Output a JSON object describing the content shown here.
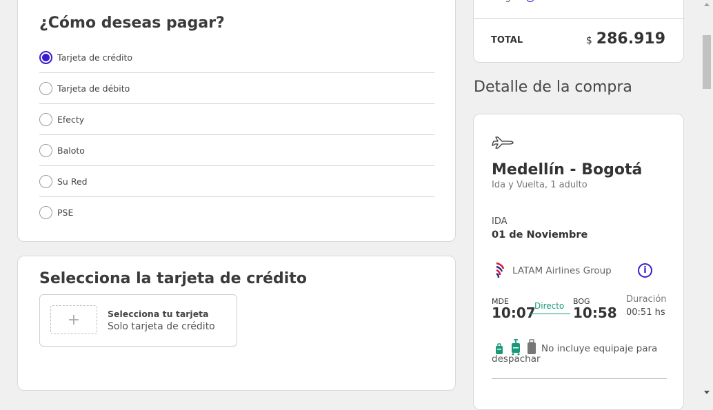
{
  "payment": {
    "title": "¿Cómo deseas pagar?",
    "options": [
      {
        "label": "Tarjeta de crédito",
        "selected": true
      },
      {
        "label": "Tarjeta de débito",
        "selected": false
      },
      {
        "label": "Efecty",
        "selected": false
      },
      {
        "label": "Baloto",
        "selected": false
      },
      {
        "label": "Su Red",
        "selected": false
      },
      {
        "label": "PSE",
        "selected": false
      }
    ]
  },
  "credit_card": {
    "title": "Selecciona la tarjeta de crédito",
    "select_title": "Selecciona tu tarjeta",
    "select_subtitle": "Solo tarjeta de crédito",
    "plus_symbol": "+"
  },
  "summary": {
    "cargos_partial": "cargos",
    "total_label": "TOTAL",
    "currency": "$",
    "total_amount": "286.919"
  },
  "detail": {
    "title": "Detalle de la compra",
    "route": "Medellín - Bogotá",
    "trip_type": "Ida y Vuelta, 1 adulto",
    "leg_label": "IDA",
    "leg_date": "01 de Noviembre",
    "airline": "LATAM Airlines Group",
    "info_symbol": "i",
    "origin_code": "MDE",
    "origin_time": "10:07",
    "stops": "Directo",
    "dest_code": "BOG",
    "dest_time": "10:58",
    "duration_label": "Duración",
    "duration_value": "00:51 hs",
    "baggage_text": "No incluye equipaje para despachar"
  },
  "colors": {
    "accent": "#3a1ccf",
    "direct": "#1a9a7a",
    "baggage_included": "#1a9a7a",
    "baggage_excluded": "#777777"
  }
}
